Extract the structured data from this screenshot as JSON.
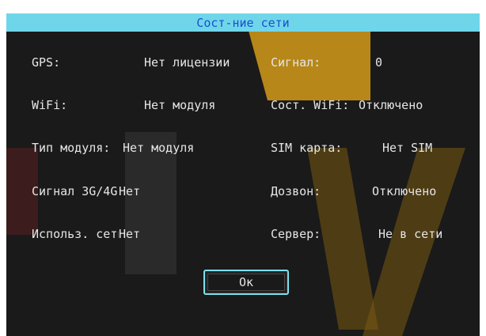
{
  "title": "Сост-ние сети",
  "rows": [
    {
      "l1": "GPS:",
      "v1": "Нет лицензии",
      "l2": "Сигнал:",
      "v2": "0"
    },
    {
      "l1": "WiFi:",
      "v1": "Нет модуля",
      "l2": "Сост. WiFi:",
      "v2": "Отключено"
    },
    {
      "l1": "Тип модуля:",
      "v1": "Нет модуля",
      "l2": "SIM карта:",
      "v2": "Нет SIM"
    },
    {
      "l1": "Сигнал 3G/4G",
      "v1": "Нет",
      "l2": "Дозвон:",
      "v2": "Отключено"
    },
    {
      "l1": "Использ. сеть",
      "v1": "Нет",
      "l2": "Сервер:",
      "v2": "Не в сети"
    }
  ],
  "ok_label": "Ок",
  "colors": {
    "titlebar": "#6fd6ea",
    "title_text": "#1a4fd0",
    "background": "#1a1a1a",
    "text": "#e6e6e6",
    "button_border": "#7ee0ee"
  }
}
